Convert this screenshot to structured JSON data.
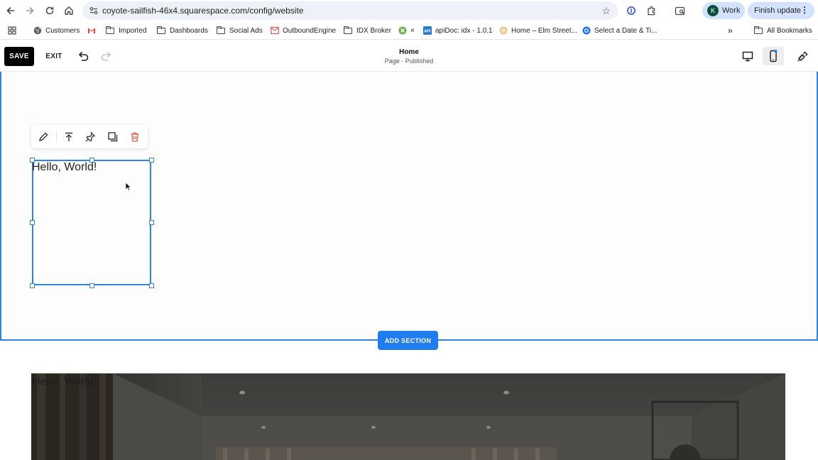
{
  "browser": {
    "url": "coyote-sailfish-46x4.squarespace.com/config/website",
    "profile_initial": "K",
    "profile_label": "Work",
    "finish_update_label": "Finish update"
  },
  "bookmarks": {
    "items": [
      {
        "label": "Customers",
        "icon": "globe-icon"
      },
      {
        "label": "",
        "icon": "gmail-icon"
      },
      {
        "label": "Imported",
        "icon": "folder-icon"
      },
      {
        "label": "Dashboards",
        "icon": "folder-icon"
      },
      {
        "label": "Social Ads",
        "icon": "folder-icon"
      },
      {
        "label": "OutboundEngine",
        "icon": "outboundengine-icon"
      },
      {
        "label": "IDX Broker",
        "icon": "folder-icon"
      },
      {
        "label": "×",
        "icon": "x-app-icon"
      },
      {
        "label": "apiDoc: idx - 1.0.1",
        "icon": "apidoc-icon"
      },
      {
        "label": "Home – Elm Street...",
        "icon": "elm-street-icon"
      },
      {
        "label": "Select a Date & Ti...",
        "icon": "calendar-app-icon"
      }
    ],
    "overflow_label": "»",
    "all_bookmarks_label": "All Bookmarks"
  },
  "editor": {
    "save_label": "SAVE",
    "exit_label": "EXIT",
    "page_title": "Home",
    "page_status": "Page · Published",
    "add_section_label": "ADD SECTION"
  },
  "content": {
    "text_block_1": "Hello, World!",
    "text_block_2": "Hello, World!"
  },
  "colors": {
    "accent": "#2f84e0",
    "add_section": "#1f7df0",
    "save_bg": "#000000",
    "delete_icon": "#e05a4e"
  }
}
